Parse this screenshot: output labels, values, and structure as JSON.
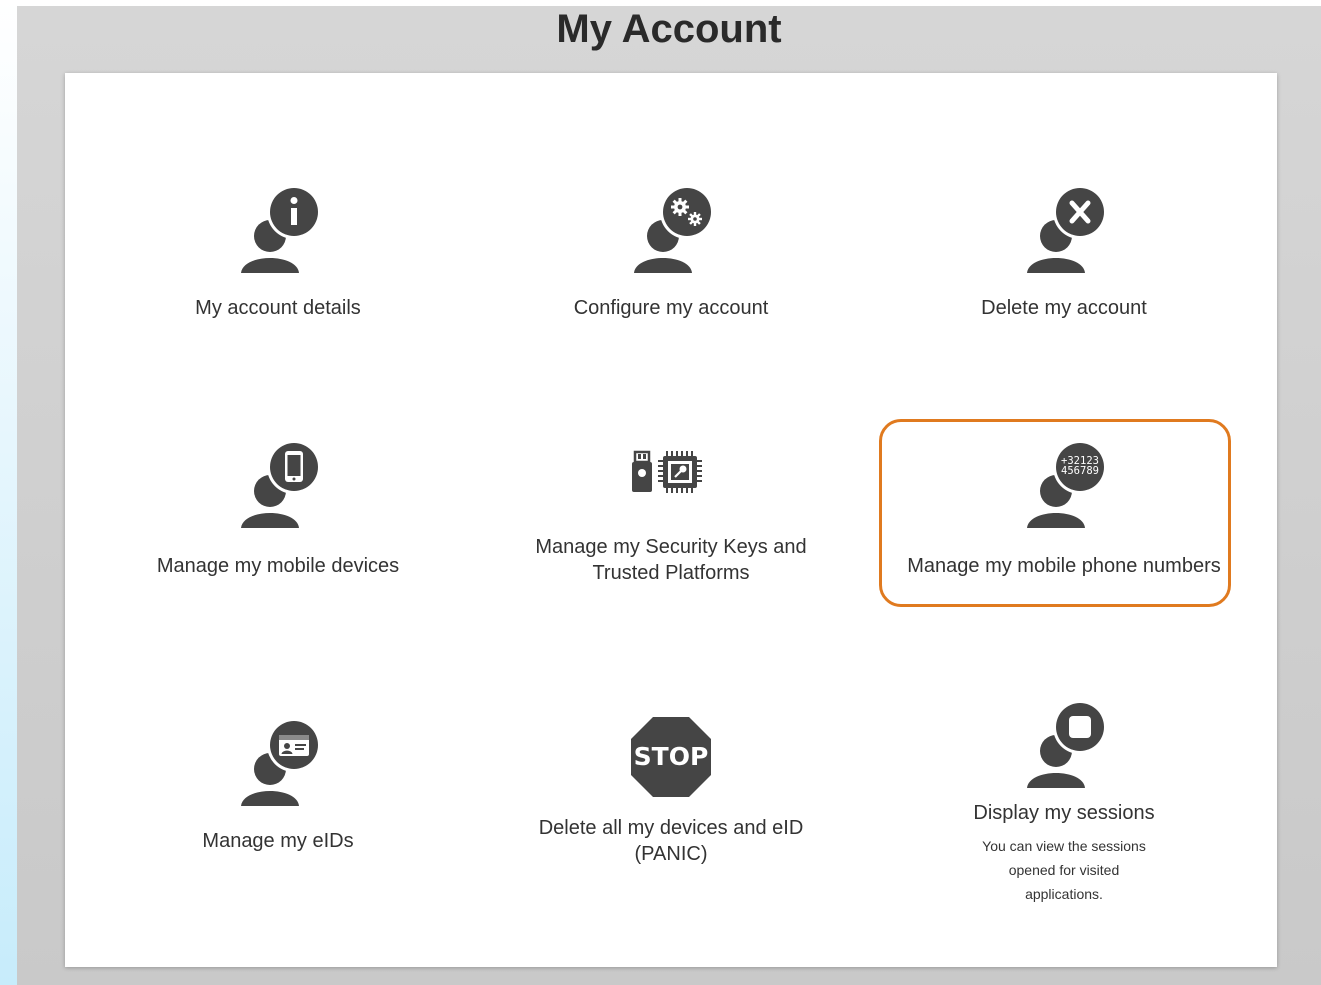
{
  "page": {
    "title": "My Account"
  },
  "colors": {
    "icon": "#454545",
    "highlight": "#e07a1f",
    "text": "#333333"
  },
  "tiles": [
    {
      "id": "details",
      "label": "My account details",
      "icon": "user-info-icon"
    },
    {
      "id": "configure",
      "label": "Configure my account",
      "icon": "user-gears-icon"
    },
    {
      "id": "delete",
      "label": "Delete my account",
      "icon": "user-x-icon"
    },
    {
      "id": "mobile-devices",
      "label": "Manage my mobile devices",
      "icon": "user-phone-icon"
    },
    {
      "id": "security-keys",
      "label": "Manage my Security Keys and Trusted Platforms",
      "icon": "security-key-chip-icon"
    },
    {
      "id": "phone-numbers",
      "label": "Manage my mobile phone numbers",
      "icon": "user-phone-number-icon",
      "icon_text_1": "+32123",
      "icon_text_2": "456789",
      "highlighted": true
    },
    {
      "id": "eids",
      "label": "Manage my eIDs",
      "icon": "user-id-card-icon"
    },
    {
      "id": "panic",
      "label": "Delete all my devices and eID (PANIC)",
      "icon": "stop-sign-icon",
      "icon_text": "STOP"
    },
    {
      "id": "sessions",
      "label": "Display my sessions",
      "description": "You can view the sessions opened for visited applications.",
      "icon": "user-session-icon"
    }
  ]
}
